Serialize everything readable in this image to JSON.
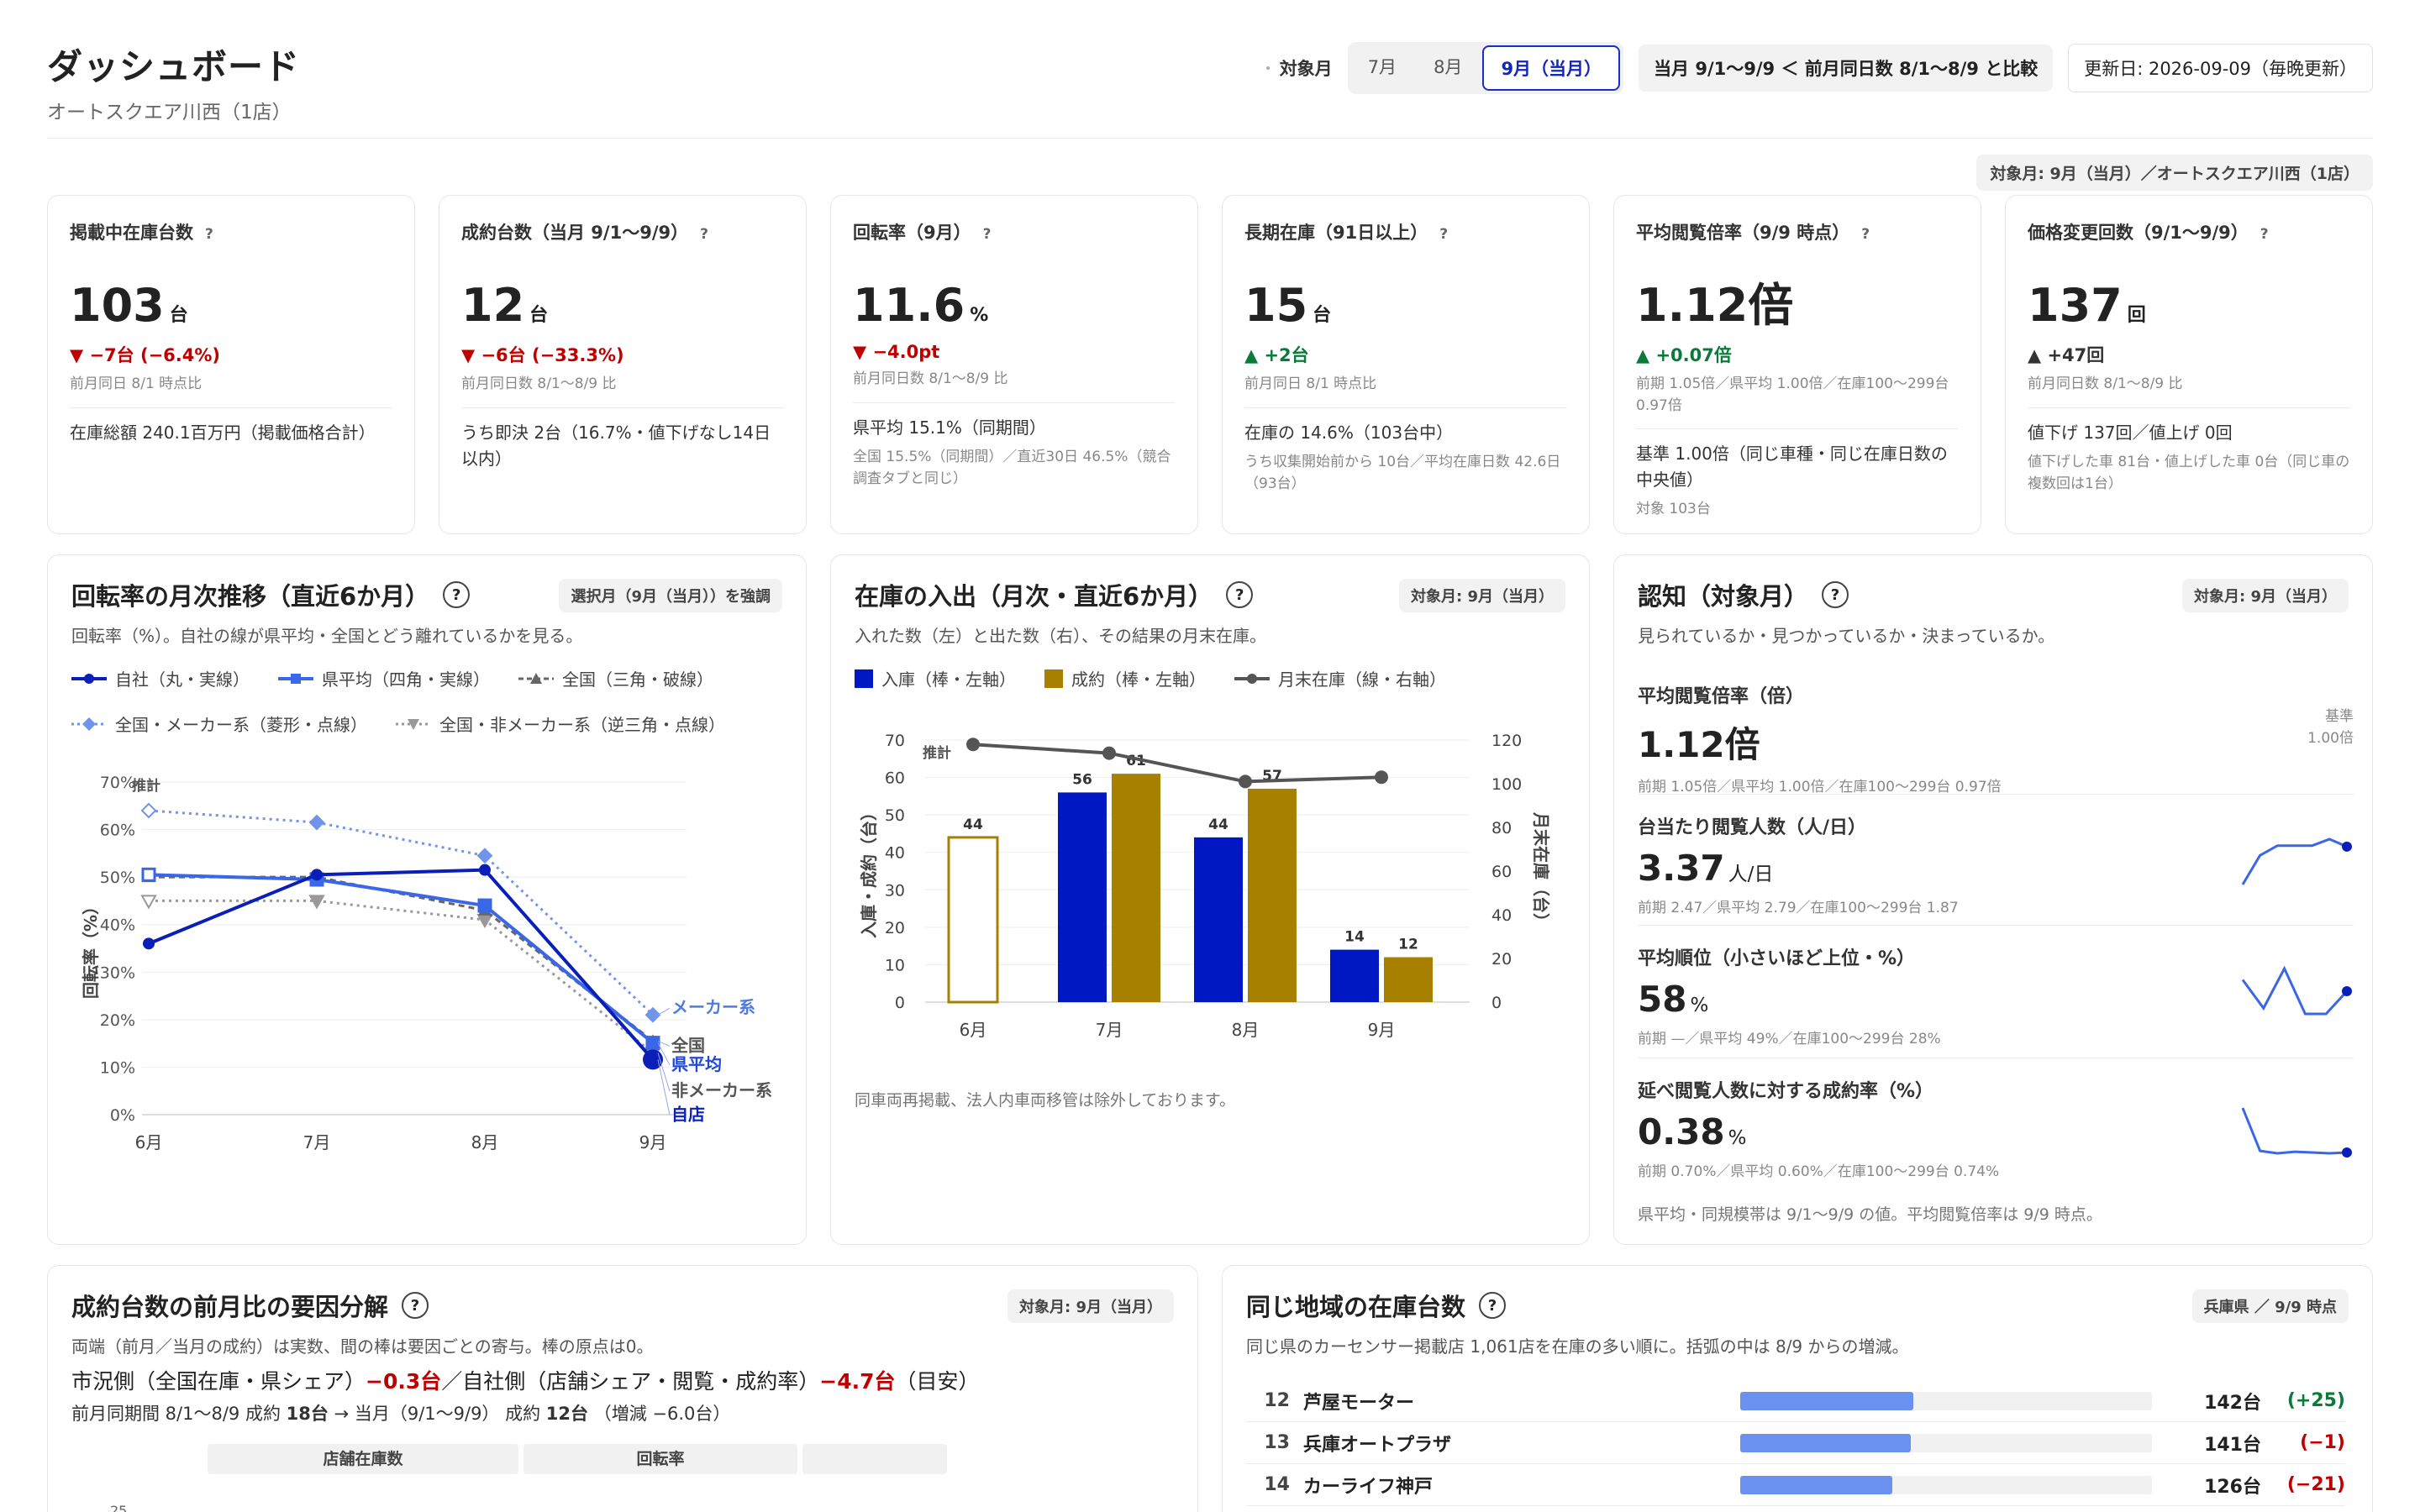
{
  "header": {
    "title": "ダッシュボード",
    "subtitle": "オートスクエア川西（1店）",
    "month_label": "対象月",
    "months": [
      "7月",
      "8月",
      "9月（当月）"
    ],
    "compare": "当月 9/1〜9/9 ＜ 前月同日数 8/1〜8/9 と比較",
    "updated": "更新日: 2026-09-09（毎晩更新）",
    "scope": "対象月: 9月（当月）／オートスクエア川西（1店）"
  },
  "kpis": [
    {
      "title": "掲載中在庫台数",
      "q": "?",
      "value": "103",
      "unit": "台",
      "delta": "▼ −7台 (−6.4%)",
      "dir": "down",
      "cmp": "前月同日 8/1 時点比",
      "main": "在庫総額 240.1百万円（掲載価格合計）",
      "sub": ""
    },
    {
      "title": "成約台数（当月 9/1〜9/9）",
      "q": "?",
      "value": "12",
      "unit": "台",
      "delta": "▼ −6台 (−33.3%)",
      "dir": "down",
      "cmp": "前月同日数 8/1〜8/9 比",
      "main": "うち即決 2台（16.7%・値下げなし14日以内）",
      "sub": ""
    },
    {
      "title": "回転率（9月）",
      "q": "?",
      "value": "11.6",
      "unit": "%",
      "delta": "▼ −4.0pt",
      "dir": "down",
      "cmp": "前月同日数 8/1〜8/9 比",
      "main": "県平均 15.1%（同期間）",
      "sub": "全国 15.5%（同期間）／直近30日 46.5%（競合調査タブと同じ）"
    },
    {
      "title": "長期在庫（91日以上）",
      "q": "?",
      "value": "15",
      "unit": "台",
      "delta": "▲ +2台",
      "dir": "up",
      "cmp": "前月同日 8/1 時点比",
      "main": "在庫の 14.6%（103台中）",
      "sub": "うち収集開始前から 10台／平均在庫日数 42.6日（93台）"
    },
    {
      "title": "平均閲覧倍率（9/9 時点）",
      "q": "?",
      "value": "1.12倍",
      "unit": "",
      "delta": "▲ +0.07倍",
      "dir": "up",
      "cmp": "前期 1.05倍／県平均 1.00倍／在庫100〜299台 0.97倍",
      "main": "基準 1.00倍（同じ車種・同じ在庫日数の中央値）",
      "sub": "対象 103台"
    },
    {
      "title": "価格変更回数（9/1〜9/9）",
      "q": "?",
      "value": "137",
      "unit": "回",
      "delta": "▲ +47回",
      "dir": "neu",
      "cmp": "前月同日数 8/1〜8/9 比",
      "main": "値下げ 137回／値上げ 0回",
      "sub": "値下げした車 81台・値上げした車 0台（同じ車の複数回は1台）"
    }
  ],
  "turnover": {
    "title": "回転率の月次推移（直近6か月）",
    "tag": "選択月（9月（当月））を強調",
    "sub": "回転率（%）。自社の線が県平均・全国とどう離れているかを見る。",
    "legend": [
      "自社（丸・実線）",
      "県平均（四角・実線）",
      "全国（三角・破線）",
      "全国・メーカー系（菱形・点線）",
      "全国・非メーカー系（逆三角・点線）"
    ],
    "estimate": "推計",
    "ylabel": "回転率（%）"
  },
  "inout": {
    "title": "在庫の入出（月次・直近6か月）",
    "tag": "対象月: 9月（当月）",
    "sub": "入れた数（左）と出た数（右）、その結果の月末在庫。",
    "legend": [
      "入庫（棒・左軸）",
      "成約（棒・左軸）",
      "月末在庫（線・右軸）"
    ],
    "estimate": "推計",
    "yl": "入庫・成約（台）",
    "yr": "月末在庫（台）",
    "note": "同車両再掲載、法人内車両移管は除外しております。"
  },
  "notice": {
    "title": "認知（対象月）",
    "tag": "対象月: 9月（当月）",
    "sub": "見られているか・見つかっているか・決まっているか。",
    "items": [
      {
        "label": "平均閲覧倍率（倍）",
        "value": "1.12倍",
        "unit": "",
        "cmp": "前期 1.05倍／県平均 1.00倍／在庫100〜299台 0.97倍",
        "base_label": "基準",
        "base_value": "1.00倍"
      },
      {
        "label": "台当たり閲覧人数（人/日）",
        "value": "3.37",
        "unit": "人/日",
        "cmp": "前期 2.47／県平均 2.79／在庫100〜299台 1.87"
      },
      {
        "label": "平均順位（小さいほど上位・%）",
        "value": "58",
        "unit": "%",
        "cmp": "前期 —／県平均 49%／在庫100〜299台 28%"
      },
      {
        "label": "延べ閲覧人数に対する成約率（%）",
        "value": "0.38",
        "unit": "%",
        "cmp": "前期 0.70%／県平均 0.60%／在庫100〜299台 0.74%"
      }
    ],
    "foot": "県平均・同規模帯は 9/1〜9/9 の値。平均閲覧倍率は 9/9 時点。"
  },
  "decomp": {
    "title": "成約台数の前月比の要因分解",
    "tag": "対象月: 9月（当月）",
    "sub": "両端（前月／当月の成約）は実数、間の棒は要因ごとの寄与。棒の原点は0。",
    "line_a": "市況側（全国在庫・県シェア）",
    "val_a": "−0.3台",
    "sep": "／",
    "line_b": "自社側（店舗シェア・閲覧・成約率）",
    "val_b": "−4.7台",
    "tail": "（目安）",
    "line2": "前月同期間 8/1〜8/9 成約",
    "v2a": "18台",
    "arrow": "→ 当月（9/1〜9/9） 成約",
    "v2b": "12台",
    "v2c": "（増減 −6.0台）",
    "cols": [
      "店舗在庫数",
      "回転率",
      ""
    ],
    "tick": "25"
  },
  "region": {
    "title": "同じ地域の在庫台数",
    "tag": "兵庫県 ／ 9/9 時点",
    "sub": "同じ県のカーセンサー掲載店 1,061店を在庫の多い順に。括弧の中は 8/9 からの増減。",
    "rows": [
      {
        "rank": "12",
        "name": "芦屋モーター",
        "count": "142台",
        "delta": "(+25)",
        "dir": "up",
        "frac": 0.42
      },
      {
        "rank": "13",
        "name": "兵庫オートプラザ",
        "count": "141台",
        "delta": "(−1)",
        "dir": "down",
        "frac": 0.415
      },
      {
        "rank": "14",
        "name": "カーライフ神戸",
        "count": "126台",
        "delta": "(−21)",
        "dir": "down",
        "frac": 0.37
      }
    ]
  },
  "chart_data": [
    {
      "type": "line",
      "title": "回転率の月次推移（直近6か月）",
      "categories": [
        "6月",
        "7月",
        "8月",
        "9月"
      ],
      "ylim": [
        0,
        70
      ],
      "ylabel": "回転率（%）",
      "yticks": [
        "0%",
        "10%",
        "20%",
        "30%",
        "40%",
        "50%",
        "60%",
        "70%"
      ],
      "series": [
        {
          "name": "自社",
          "values": [
            36,
            50.5,
            51.5,
            11.6
          ],
          "color": "#0a1fb8",
          "end_label": "自店"
        },
        {
          "name": "県平均",
          "values": [
            50.5,
            49.5,
            44,
            15.1
          ],
          "color": "#3a66e8",
          "end_label": "県平均"
        },
        {
          "name": "全国",
          "values": [
            50,
            50,
            43,
            15.5
          ],
          "color": "#666666",
          "end_label": "全国"
        },
        {
          "name": "全国・メーカー系",
          "values": [
            64,
            61.5,
            54.5,
            21
          ],
          "color": "#6f94ea",
          "end_label": "メーカー系"
        },
        {
          "name": "全国・非メーカー系",
          "values": [
            45,
            45,
            41,
            13
          ],
          "color": "#999999",
          "end_label": "非メーカー系"
        }
      ]
    },
    {
      "type": "bar",
      "title": "在庫の入出（月次・直近6か月）",
      "categories": [
        "6月",
        "7月",
        "8月",
        "9月"
      ],
      "ylim_left": [
        0,
        70
      ],
      "ylim_right": [
        0,
        120
      ],
      "yticks_left": [
        "0",
        "10",
        "20",
        "30",
        "40",
        "50",
        "60",
        "70"
      ],
      "yticks_right": [
        "0",
        "20",
        "40",
        "60",
        "80",
        "100",
        "120"
      ],
      "series": [
        {
          "name": "入庫",
          "values": [
            44,
            56,
            44,
            14
          ],
          "color": "#0018c4"
        },
        {
          "name": "成約",
          "values": [
            null,
            61,
            57,
            12
          ],
          "color": "#a88000"
        },
        {
          "name": "月末在庫",
          "values": [
            118,
            114,
            101,
            103
          ],
          "color": "#555555"
        }
      ]
    },
    {
      "type": "line",
      "title": "台当たり閲覧人数",
      "values": [
        2.2,
        3.1,
        3.4,
        3.4,
        3.4,
        3.6,
        3.37
      ]
    },
    {
      "type": "line",
      "title": "平均順位",
      "values": [
        62,
        52,
        66,
        50,
        50,
        58
      ]
    },
    {
      "type": "line",
      "title": "延べ閲覧人数に対する成約率",
      "values": [
        1.5,
        0.42,
        0.36,
        0.4,
        0.38,
        0.36,
        0.38
      ]
    }
  ]
}
